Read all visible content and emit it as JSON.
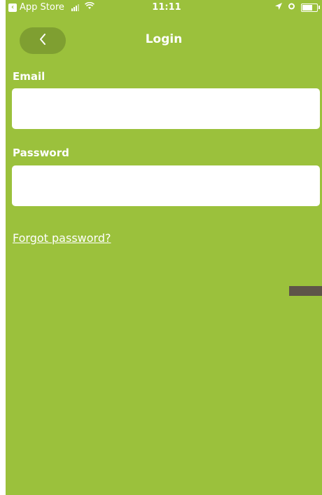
{
  "status_bar": {
    "back_app_label": "App Store",
    "time": "11:11"
  },
  "nav": {
    "title": "Login",
    "back_icon": "chevron-left-icon"
  },
  "form": {
    "email_label": "Email",
    "email_value": "",
    "email_placeholder": "",
    "password_label": "Password",
    "password_value": "",
    "password_placeholder": ""
  },
  "links": {
    "forgot_password": "Forgot password?"
  },
  "colors": {
    "background": "#9bc13c",
    "back_button": "#7f9f31",
    "side_handle": "#5e5449"
  }
}
